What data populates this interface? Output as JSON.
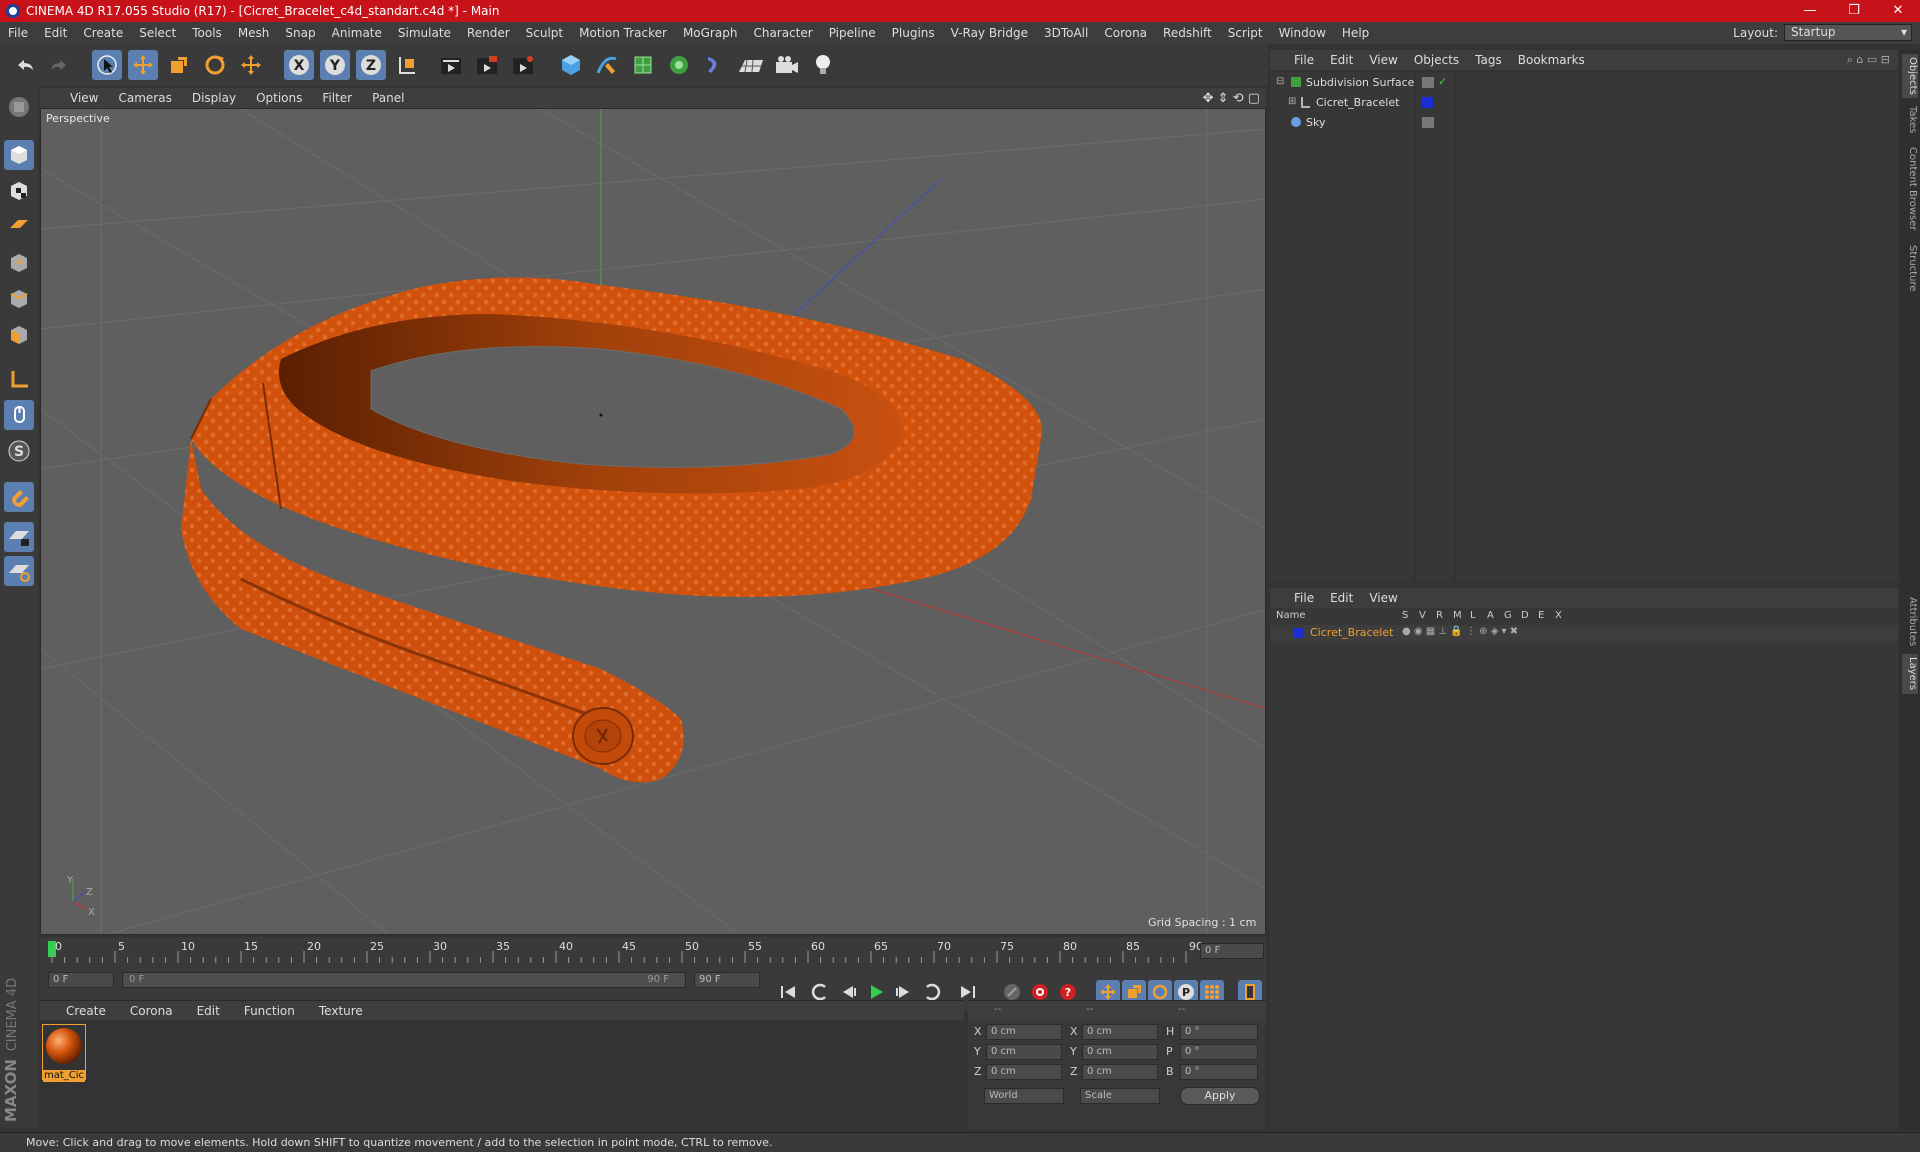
{
  "window": {
    "title": "CINEMA 4D R17.055 Studio (R17) - [Cicret_Bracelet_c4d_standart.c4d *] - Main"
  },
  "menubar": [
    "File",
    "Edit",
    "Create",
    "Select",
    "Tools",
    "Mesh",
    "Snap",
    "Animate",
    "Simulate",
    "Render",
    "Sculpt",
    "Motion Tracker",
    "MoGraph",
    "Character",
    "Pipeline",
    "Plugins",
    "V-Ray Bridge",
    "3DToAll",
    "Corona",
    "Redshift",
    "Script",
    "Window",
    "Help"
  ],
  "layout": {
    "label": "Layout:",
    "value": "Startup"
  },
  "viewport": {
    "menu": [
      "View",
      "Cameras",
      "Display",
      "Options",
      "Filter",
      "Panel"
    ],
    "camera_label": "Perspective",
    "grid_spacing": "Grid Spacing : 1 cm"
  },
  "timeline": {
    "ticks": [
      "0",
      "5",
      "10",
      "15",
      "20",
      "25",
      "30",
      "35",
      "40",
      "45",
      "50",
      "55",
      "60",
      "65",
      "70",
      "75",
      "80",
      "85",
      "90"
    ],
    "current_frame": "0 F",
    "start_field": "0 F",
    "range_start": "0 F",
    "range_end": "90 F",
    "end_field": "90 F"
  },
  "material_manager": {
    "menu": [
      "Create",
      "Corona",
      "Edit",
      "Function",
      "Texture"
    ],
    "materials": [
      {
        "name": "mat_Cic"
      }
    ]
  },
  "coordinates": {
    "headers": [
      "--",
      "--",
      "--"
    ],
    "rows": [
      {
        "a": "X",
        "av": "0 cm",
        "b": "X",
        "bv": "0 cm",
        "c": "H",
        "cv": "0 °"
      },
      {
        "a": "Y",
        "av": "0 cm",
        "b": "Y",
        "bv": "0 cm",
        "c": "P",
        "cv": "0 °"
      },
      {
        "a": "Z",
        "av": "0 cm",
        "b": "Z",
        "bv": "0 cm",
        "c": "B",
        "cv": "0 °"
      }
    ],
    "world": "World",
    "scale": "Scale",
    "apply": "Apply"
  },
  "object_manager": {
    "menu": [
      "File",
      "Edit",
      "View",
      "Objects",
      "Tags",
      "Bookmarks"
    ],
    "objects": [
      "Subdivision Surface",
      "Cicret_Bracelet",
      "Sky"
    ]
  },
  "layer_manager": {
    "menu": [
      "File",
      "Edit",
      "View"
    ],
    "columns": [
      "Name",
      "S",
      "V",
      "R",
      "M",
      "L",
      "A",
      "G",
      "D",
      "E",
      "X"
    ],
    "layers": [
      {
        "name": "Cicret_Bracelet",
        "color": "#1c2fd6"
      }
    ]
  },
  "right_tabs": [
    "Objects",
    "Takes",
    "Content Browser",
    "Structure",
    "Attributes",
    "Layers"
  ],
  "status": "Move: Click and drag to move elements. Hold down SHIFT to quantize movement / add to the selection in point mode, CTRL to remove.",
  "brand": {
    "maxon": "MAXON",
    "c4d": "CINEMA 4D"
  },
  "colors": {
    "titlebar": "#c8121a",
    "accent": "#5a7fb0",
    "bracelet": "#d2520c",
    "highlight": "#f0a030"
  }
}
